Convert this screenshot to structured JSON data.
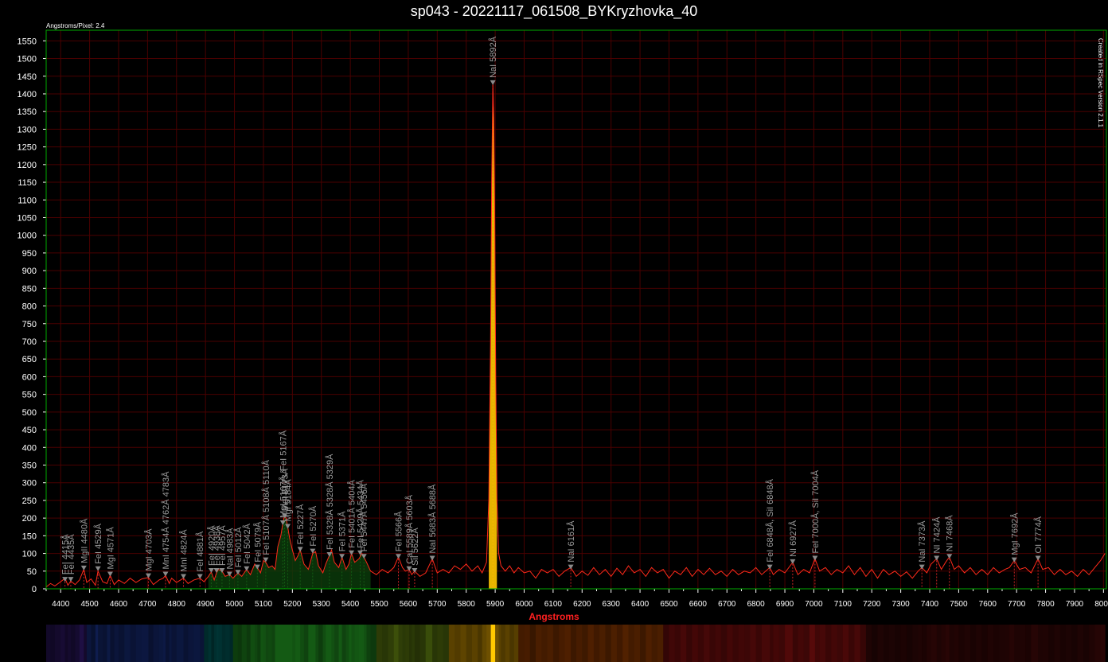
{
  "window_title": "sp043 - 20221117_061508_BYKryzhovka_40",
  "dispersion_label": "Angstroms/Pixel: 2.4",
  "credit": "Created in RSpec Version 2.1.1",
  "colors": {
    "background": "#000000",
    "grid": "#4a0000",
    "frame": "#00aa00",
    "spectrum": "#ff2a1a",
    "peak_fill": "#ffc800",
    "annotation": "#9a9a9a",
    "axis_title": "#ff2020"
  },
  "chart_data": {
    "type": "line",
    "title": "sp043 - 20221117_061508_BYKryzhovka_40",
    "xlabel": "Angstroms",
    "ylabel": "",
    "xlim": [
      4350,
      8010
    ],
    "ylim": [
      0,
      1580
    ],
    "grid": true,
    "x_ticks": [
      4400,
      4500,
      4600,
      4700,
      4800,
      4900,
      5000,
      5100,
      5200,
      5300,
      5400,
      5500,
      5600,
      5700,
      5800,
      5900,
      6000,
      6100,
      6200,
      6300,
      6400,
      6500,
      6600,
      6700,
      6800,
      6900,
      7000,
      7100,
      7200,
      7300,
      7400,
      7500,
      7600,
      7700,
      7800,
      7900,
      8000
    ],
    "y_ticks": [
      0,
      50,
      100,
      150,
      200,
      250,
      300,
      350,
      400,
      450,
      500,
      550,
      600,
      650,
      700,
      750,
      800,
      850,
      900,
      950,
      1000,
      1050,
      1100,
      1150,
      1200,
      1250,
      1300,
      1350,
      1400,
      1450,
      1500,
      1550
    ],
    "series": [
      {
        "points": [
          [
            4350,
            5
          ],
          [
            4365,
            15
          ],
          [
            4380,
            8
          ],
          [
            4400,
            20
          ],
          [
            4415,
            30
          ],
          [
            4425,
            10
          ],
          [
            4435,
            22
          ],
          [
            4450,
            12
          ],
          [
            4465,
            25
          ],
          [
            4480,
            55
          ],
          [
            4490,
            18
          ],
          [
            4505,
            28
          ],
          [
            4520,
            10
          ],
          [
            4529,
            50
          ],
          [
            4545,
            20
          ],
          [
            4560,
            15
          ],
          [
            4571,
            38
          ],
          [
            4585,
            12
          ],
          [
            4600,
            25
          ],
          [
            4620,
            15
          ],
          [
            4640,
            30
          ],
          [
            4660,
            18
          ],
          [
            4680,
            28
          ],
          [
            4703,
            32
          ],
          [
            4720,
            12
          ],
          [
            4740,
            25
          ],
          [
            4754,
            30
          ],
          [
            4762,
            38
          ],
          [
            4775,
            15
          ],
          [
            4783,
            30
          ],
          [
            4800,
            18
          ],
          [
            4824,
            30
          ],
          [
            4840,
            15
          ],
          [
            4860,
            25
          ],
          [
            4881,
            30
          ],
          [
            4895,
            20
          ],
          [
            4910,
            35
          ],
          [
            4920,
            48
          ],
          [
            4930,
            25
          ],
          [
            4938,
            45
          ],
          [
            4945,
            55
          ],
          [
            4957,
            50
          ],
          [
            4968,
            35
          ],
          [
            4983,
            40
          ],
          [
            4995,
            30
          ],
          [
            5012,
            45
          ],
          [
            5025,
            35
          ],
          [
            5042,
            55
          ],
          [
            5055,
            40
          ],
          [
            5070,
            70
          ],
          [
            5079,
            60
          ],
          [
            5090,
            45
          ],
          [
            5100,
            80
          ],
          [
            5108,
            75
          ],
          [
            5118,
            60
          ],
          [
            5130,
            65
          ],
          [
            5140,
            55
          ],
          [
            5150,
            120
          ],
          [
            5160,
            150
          ],
          [
            5167,
            185
          ],
          [
            5172,
            205
          ],
          [
            5178,
            200
          ],
          [
            5184,
            175
          ],
          [
            5190,
            145
          ],
          [
            5200,
            110
          ],
          [
            5210,
            80
          ],
          [
            5220,
            95
          ],
          [
            5227,
            110
          ],
          [
            5240,
            70
          ],
          [
            5255,
            55
          ],
          [
            5270,
            100
          ],
          [
            5280,
            105
          ],
          [
            5290,
            65
          ],
          [
            5305,
            45
          ],
          [
            5315,
            70
          ],
          [
            5328,
            95
          ],
          [
            5335,
            110
          ],
          [
            5345,
            75
          ],
          [
            5360,
            60
          ],
          [
            5371,
            90
          ],
          [
            5385,
            55
          ],
          [
            5395,
            70
          ],
          [
            5404,
            100
          ],
          [
            5415,
            75
          ],
          [
            5430,
            85
          ],
          [
            5440,
            100
          ],
          [
            5447,
            90
          ],
          [
            5456,
            75
          ],
          [
            5470,
            50
          ],
          [
            5490,
            40
          ],
          [
            5510,
            55
          ],
          [
            5530,
            45
          ],
          [
            5550,
            60
          ],
          [
            5566,
            90
          ],
          [
            5580,
            60
          ],
          [
            5590,
            50
          ],
          [
            5603,
            55
          ],
          [
            5612,
            40
          ],
          [
            5622,
            50
          ],
          [
            5640,
            35
          ],
          [
            5660,
            45
          ],
          [
            5683,
            85
          ],
          [
            5700,
            45
          ],
          [
            5720,
            55
          ],
          [
            5740,
            45
          ],
          [
            5760,
            65
          ],
          [
            5780,
            55
          ],
          [
            5800,
            70
          ],
          [
            5820,
            50
          ],
          [
            5840,
            65
          ],
          [
            5855,
            45
          ],
          [
            5870,
            75
          ],
          [
            5878,
            250
          ],
          [
            5884,
            700
          ],
          [
            5888,
            1150
          ],
          [
            5892,
            1430
          ],
          [
            5895,
            1330
          ],
          [
            5898,
            1100
          ],
          [
            5902,
            600
          ],
          [
            5906,
            250
          ],
          [
            5912,
            100
          ],
          [
            5920,
            65
          ],
          [
            5935,
            50
          ],
          [
            5950,
            65
          ],
          [
            5965,
            45
          ],
          [
            5980,
            60
          ],
          [
            6000,
            45
          ],
          [
            6020,
            50
          ],
          [
            6040,
            30
          ],
          [
            6060,
            55
          ],
          [
            6080,
            45
          ],
          [
            6100,
            55
          ],
          [
            6120,
            35
          ],
          [
            6140,
            50
          ],
          [
            6161,
            60
          ],
          [
            6180,
            35
          ],
          [
            6200,
            50
          ],
          [
            6220,
            38
          ],
          [
            6240,
            60
          ],
          [
            6260,
            40
          ],
          [
            6280,
            55
          ],
          [
            6300,
            35
          ],
          [
            6320,
            58
          ],
          [
            6340,
            40
          ],
          [
            6360,
            65
          ],
          [
            6380,
            45
          ],
          [
            6400,
            55
          ],
          [
            6420,
            35
          ],
          [
            6440,
            60
          ],
          [
            6460,
            45
          ],
          [
            6480,
            55
          ],
          [
            6500,
            30
          ],
          [
            6520,
            50
          ],
          [
            6540,
            40
          ],
          [
            6560,
            60
          ],
          [
            6580,
            35
          ],
          [
            6600,
            55
          ],
          [
            6620,
            40
          ],
          [
            6640,
            58
          ],
          [
            6660,
            40
          ],
          [
            6680,
            50
          ],
          [
            6700,
            35
          ],
          [
            6720,
            55
          ],
          [
            6740,
            40
          ],
          [
            6760,
            50
          ],
          [
            6780,
            45
          ],
          [
            6800,
            60
          ],
          [
            6820,
            40
          ],
          [
            6848,
            60
          ],
          [
            6860,
            40
          ],
          [
            6880,
            55
          ],
          [
            6900,
            45
          ],
          [
            6927,
            75
          ],
          [
            6945,
            40
          ],
          [
            6965,
            55
          ],
          [
            6985,
            45
          ],
          [
            7004,
            85
          ],
          [
            7020,
            50
          ],
          [
            7040,
            60
          ],
          [
            7060,
            40
          ],
          [
            7080,
            55
          ],
          [
            7100,
            45
          ],
          [
            7120,
            65
          ],
          [
            7140,
            40
          ],
          [
            7160,
            60
          ],
          [
            7180,
            35
          ],
          [
            7200,
            55
          ],
          [
            7220,
            30
          ],
          [
            7240,
            55
          ],
          [
            7260,
            40
          ],
          [
            7280,
            50
          ],
          [
            7300,
            35
          ],
          [
            7320,
            48
          ],
          [
            7340,
            30
          ],
          [
            7360,
            50
          ],
          [
            7373,
            60
          ],
          [
            7390,
            45
          ],
          [
            7405,
            70
          ],
          [
            7424,
            85
          ],
          [
            7440,
            55
          ],
          [
            7455,
            75
          ],
          [
            7468,
            90
          ],
          [
            7485,
            55
          ],
          [
            7500,
            65
          ],
          [
            7520,
            45
          ],
          [
            7540,
            60
          ],
          [
            7560,
            40
          ],
          [
            7580,
            55
          ],
          [
            7600,
            40
          ],
          [
            7620,
            60
          ],
          [
            7640,
            45
          ],
          [
            7660,
            55
          ],
          [
            7675,
            60
          ],
          [
            7692,
            80
          ],
          [
            7710,
            55
          ],
          [
            7730,
            60
          ],
          [
            7750,
            45
          ],
          [
            7774,
            85
          ],
          [
            7790,
            55
          ],
          [
            7810,
            60
          ],
          [
            7830,
            40
          ],
          [
            7850,
            55
          ],
          [
            7870,
            40
          ],
          [
            7890,
            50
          ],
          [
            7910,
            35
          ],
          [
            7930,
            55
          ],
          [
            7950,
            40
          ],
          [
            7970,
            60
          ],
          [
            7990,
            80
          ],
          [
            8005,
            100
          ]
        ]
      }
    ],
    "annotations": [
      {
        "label": "FeI 4415Å",
        "x": 4415,
        "y": 20
      },
      {
        "label": "FeI 4435Å",
        "x": 4435,
        "y": 20
      },
      {
        "label": "MgII 4480Å",
        "x": 4480,
        "y": 52
      },
      {
        "label": "FeI 4529Å",
        "x": 4529,
        "y": 50
      },
      {
        "label": "MgI 4571Å",
        "x": 4571,
        "y": 35
      },
      {
        "label": "MgI 4703Å",
        "x": 4703,
        "y": 30
      },
      {
        "label": "MnI 4754Å 4762Å 4783Å",
        "x": 4762,
        "y": 35
      },
      {
        "label": "MnI 4824Å",
        "x": 4824,
        "y": 28
      },
      {
        "label": "FeI 4881Å",
        "x": 4881,
        "y": 28
      },
      {
        "label": "FeI 4920Å",
        "x": 4920,
        "y": 45
      },
      {
        "label": "FeI 4938Å",
        "x": 4938,
        "y": 45
      },
      {
        "label": "FeI 4957Å",
        "x": 4957,
        "y": 45
      },
      {
        "label": "NaI 4983Å",
        "x": 4983,
        "y": 35
      },
      {
        "label": "FeI 5012Å",
        "x": 5012,
        "y": 40
      },
      {
        "label": "FeI 5042Å",
        "x": 5042,
        "y": 50
      },
      {
        "label": "FeI 5079Å",
        "x": 5079,
        "y": 55
      },
      {
        "label": "FeI 5107Å 5108Å 5110Å",
        "x": 5108,
        "y": 75
      },
      {
        "label": "MgI 5167Å, FeI 5167Å",
        "x": 5167,
        "y": 180
      },
      {
        "label": "MgI 5173Å",
        "x": 5173,
        "y": 200
      },
      {
        "label": "MgI 5184Å",
        "x": 5184,
        "y": 170
      },
      {
        "label": "FeI 5227Å",
        "x": 5227,
        "y": 105
      },
      {
        "label": "FeI 5270Å",
        "x": 5270,
        "y": 100
      },
      {
        "label": "FeI 5328Å 5328Å 5329Å",
        "x": 5328,
        "y": 90
      },
      {
        "label": "FeI 5371Å",
        "x": 5371,
        "y": 85
      },
      {
        "label": "FeI 5401Å 5404Å",
        "x": 5404,
        "y": 95
      },
      {
        "label": "FeI 5429Å 5434Å",
        "x": 5434,
        "y": 95
      },
      {
        "label": "FeI 5447Å 5456Å",
        "x": 5447,
        "y": 85
      },
      {
        "label": "FeI 5566Å",
        "x": 5566,
        "y": 85
      },
      {
        "label": "CaI 5589Å 5603Å",
        "x": 5603,
        "y": 50
      },
      {
        "label": "SiI 5622Å",
        "x": 5622,
        "y": 45
      },
      {
        "label": "NaI 5683Å 5688Å",
        "x": 5683,
        "y": 80
      },
      {
        "label": "NaI 5892Å",
        "x": 5892,
        "y": 1425
      },
      {
        "label": "NaI 6161Å",
        "x": 6161,
        "y": 55
      },
      {
        "label": "FeI 6848Å, SiI 6848Å",
        "x": 6848,
        "y": 55
      },
      {
        "label": "NI 6927Å",
        "x": 6927,
        "y": 70
      },
      {
        "label": "FeI 7000Å, SiI 7004Å",
        "x": 7004,
        "y": 80
      },
      {
        "label": "NaI 7373Å",
        "x": 7373,
        "y": 55
      },
      {
        "label": "NI 7424Å",
        "x": 7424,
        "y": 80
      },
      {
        "label": "NI 7468Å",
        "x": 7468,
        "y": 85
      },
      {
        "label": "MgI 7692Å",
        "x": 7692,
        "y": 75
      },
      {
        "label": "OI 7774Å",
        "x": 7774,
        "y": 80
      }
    ]
  }
}
